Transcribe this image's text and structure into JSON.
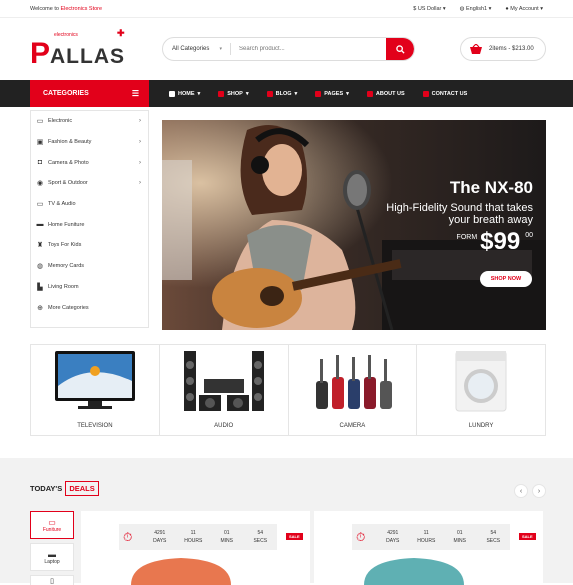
{
  "topbar": {
    "welcome_prefix": "Welcome to ",
    "welcome_store": "Electronics Store",
    "currency": "US Dollar",
    "language": "English1",
    "account": "My Account"
  },
  "header": {
    "logo_p": "P",
    "logo_rest": "ALLAS",
    "logo_tag": "electronics",
    "search_category": "All Categories",
    "search_placeholder": "Search product...",
    "cart_text": "2items - $213.00"
  },
  "nav": {
    "categories_label": "CATEGORIES",
    "items": [
      {
        "label": "HOME",
        "dropdown": true,
        "color": "#ffffff"
      },
      {
        "label": "SHOP",
        "dropdown": true,
        "color": "#e2001a"
      },
      {
        "label": "BLOG",
        "dropdown": true,
        "color": "#e2001a"
      },
      {
        "label": "PAGES",
        "dropdown": true,
        "color": "#e2001a"
      },
      {
        "label": "ABOUT US",
        "dropdown": false,
        "color": "#e2001a"
      },
      {
        "label": "CONTACT US",
        "dropdown": false,
        "color": "#e2001a"
      }
    ]
  },
  "sidebar": {
    "items": [
      {
        "label": "Electronic",
        "icon": "monitor-icon",
        "chevron": true
      },
      {
        "label": "Fashion & Beauty",
        "icon": "image-icon",
        "chevron": true
      },
      {
        "label": "Camera & Photo",
        "icon": "camera-icon",
        "chevron": true
      },
      {
        "label": "Sport & Outdoor",
        "icon": "ball-icon",
        "chevron": true
      },
      {
        "label": "TV & Audio",
        "icon": "tv-icon",
        "chevron": false
      },
      {
        "label": "Home Funiture",
        "icon": "laptop-icon",
        "chevron": false
      },
      {
        "label": "Toys For Kids",
        "icon": "toy-icon",
        "chevron": false
      },
      {
        "label": "Memory Cards",
        "icon": "globe-icon",
        "chevron": false
      },
      {
        "label": "Living Room",
        "icon": "sofa-icon",
        "chevron": false
      },
      {
        "label": "More Categories",
        "icon": "plus-circle-icon",
        "chevron": false
      }
    ]
  },
  "banner": {
    "title": "The NX-80",
    "line1": "High-Fidelity Sound that takes",
    "line2": "your breath away",
    "from_label": "FORM",
    "price": "$99",
    "cents": "00",
    "button": "SHOP NOW"
  },
  "category_strip": [
    {
      "label": "TELEVISION"
    },
    {
      "label": "AUDIO"
    },
    {
      "label": "CAMERA"
    },
    {
      "label": "LUNDRY"
    }
  ],
  "deals": {
    "title_prefix": "TODAY'S",
    "title_highlight": "DEALS",
    "prev": "‹",
    "next": "›",
    "tabs": [
      {
        "label": "Funiture",
        "active": true
      },
      {
        "label": "Laptop",
        "active": false
      }
    ],
    "cards": [
      {
        "days": "4291",
        "hours": "11",
        "mins": "01",
        "secs": "54",
        "sale": "SALE",
        "sofa_color": "#e8774f"
      },
      {
        "days": "4291",
        "hours": "11",
        "mins": "01",
        "secs": "54",
        "sale": "SALE",
        "sofa_color": "#5fb0b3"
      }
    ],
    "labels": {
      "days": "DAYS",
      "hours": "HOURS",
      "mins": "MINS",
      "secs": "SECS"
    }
  },
  "colors": {
    "accent": "#e2001a",
    "nav_bg": "#222222"
  }
}
